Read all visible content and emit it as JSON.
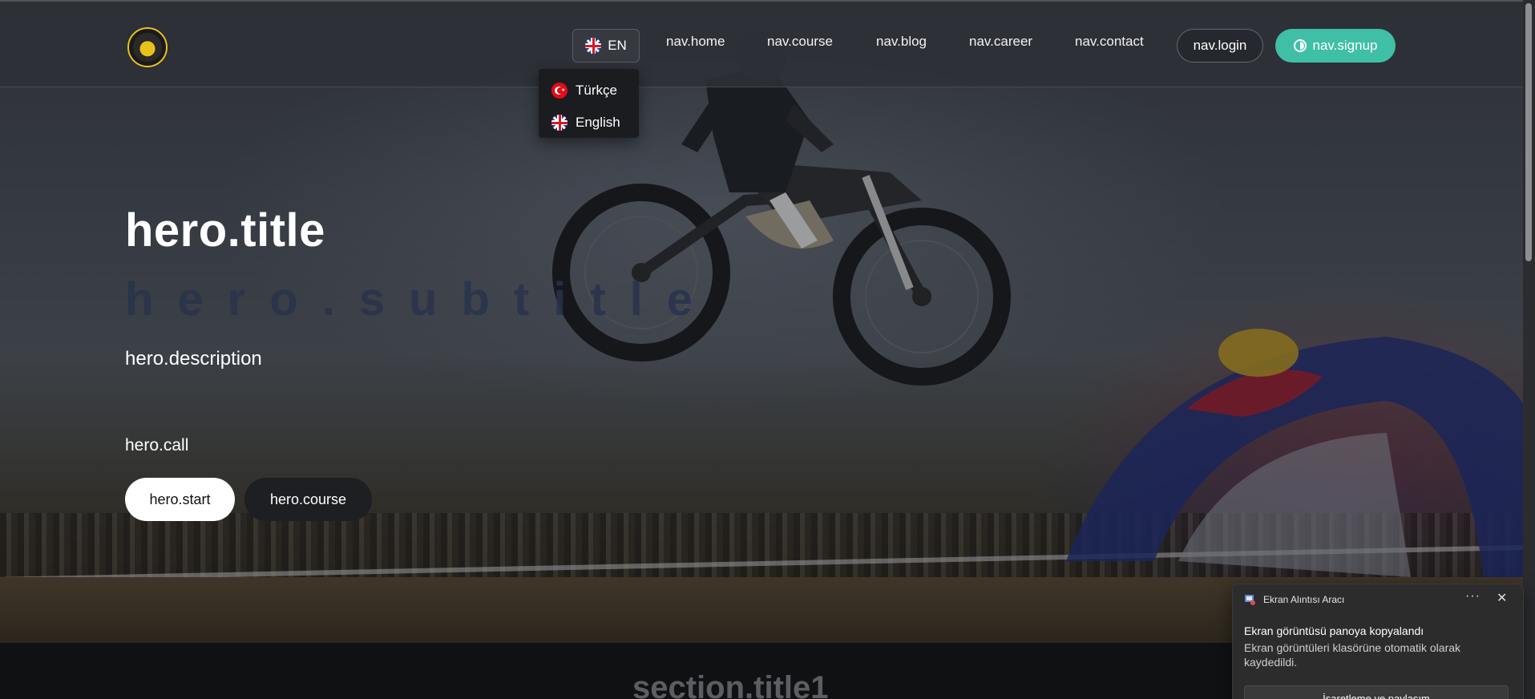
{
  "navbar": {
    "logo_icon": "motocross-academy-logo",
    "language": {
      "current_code": "EN",
      "flag_icon": "uk-flag-icon"
    },
    "links": [
      {
        "label": "nav.home"
      },
      {
        "label": "nav.course"
      },
      {
        "label": "nav.blog"
      },
      {
        "label": "nav.career"
      },
      {
        "label": "nav.contact"
      }
    ],
    "login_label": "nav.login",
    "signup_label": "nav.signup",
    "signup_color": "#3fbfa6"
  },
  "language_menu": {
    "options": [
      {
        "label": "Türkçe",
        "flag_icon": "turkey-flag-icon"
      },
      {
        "label": "English",
        "flag_icon": "uk-flag-icon"
      }
    ]
  },
  "hero": {
    "title": "hero.title",
    "subtitle": "hero.subtitle",
    "description": "hero.description",
    "call": "hero.call",
    "start_label": "hero.start",
    "course_label": "hero.course"
  },
  "section": {
    "title": "section.title1"
  },
  "notification": {
    "app_name": "Ekran Alıntısı Aracı",
    "more_icon": "more-icon",
    "close_icon": "close-icon",
    "title": "Ekran görüntüsü panoya kopyalandı",
    "body": "Ekran görüntüleri klasörüne otomatik olarak kaydedildi.",
    "action_label": "İşaretleme ve paylaşım"
  }
}
